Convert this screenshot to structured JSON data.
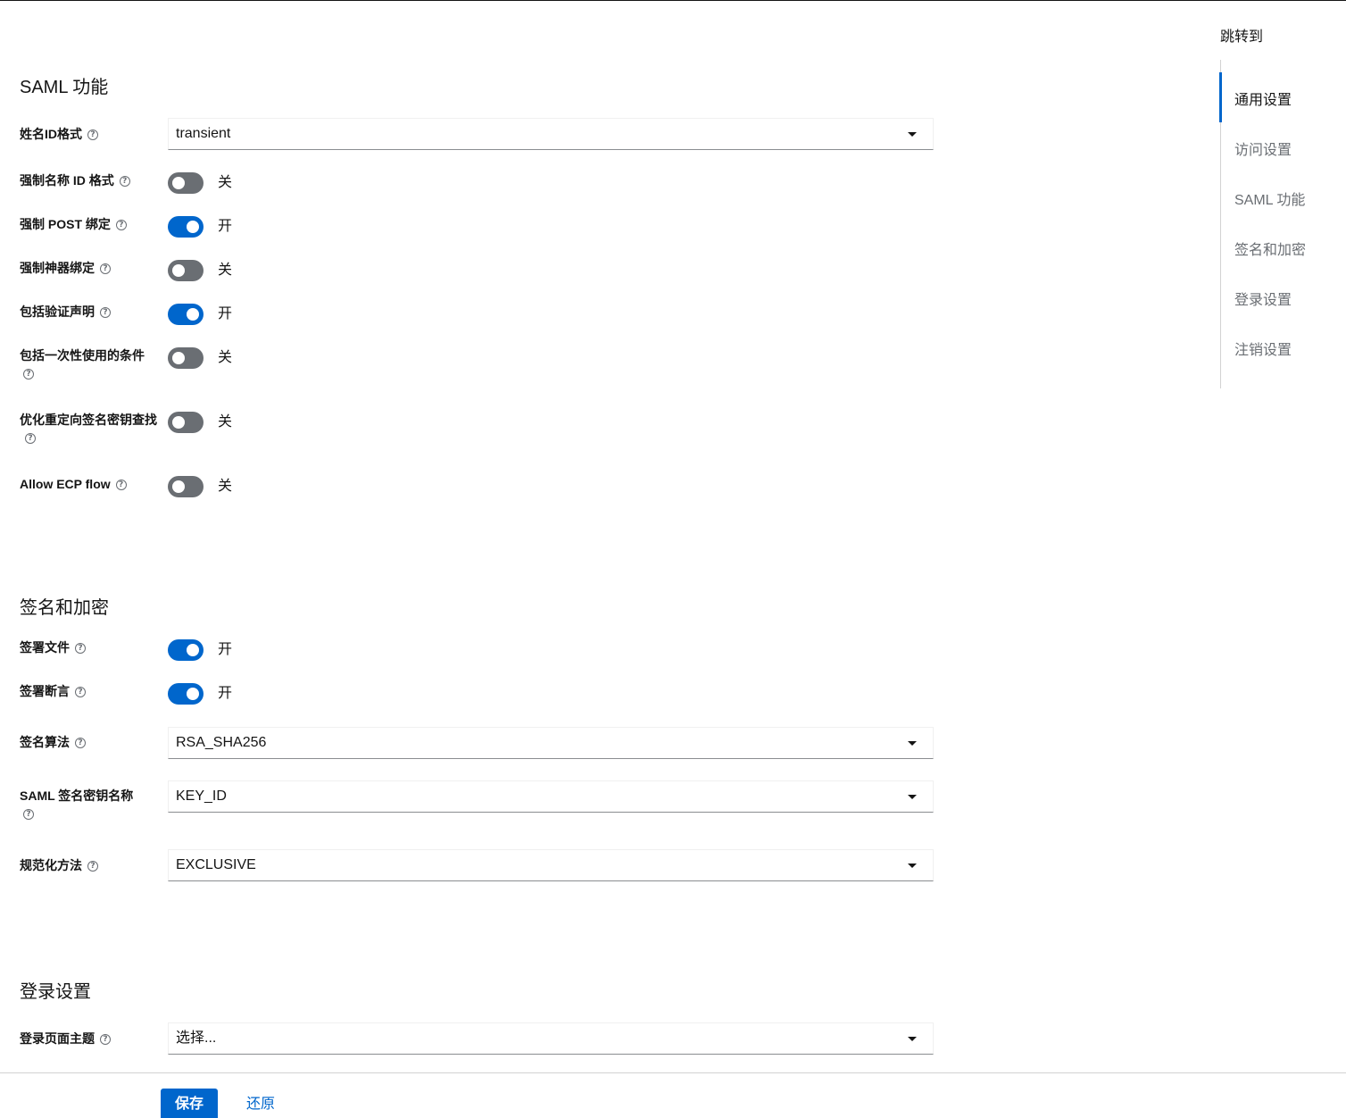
{
  "jump_to": {
    "title": "跳转到",
    "items": [
      {
        "label": "通用设置",
        "active": true
      },
      {
        "label": "访问设置",
        "active": false
      },
      {
        "label": "SAML 功能",
        "active": false
      },
      {
        "label": "签名和加密",
        "active": false
      },
      {
        "label": "登录设置",
        "active": false
      },
      {
        "label": "注销设置",
        "active": false
      }
    ]
  },
  "saml": {
    "title": "SAML 功能",
    "name_id_format": {
      "label": "姓名ID格式",
      "value": "transient"
    },
    "force_name_id_format": {
      "label": "强制名称 ID 格式",
      "state": "关",
      "on": false
    },
    "force_post_binding": {
      "label": "强制 POST 绑定",
      "state": "开",
      "on": true
    },
    "force_artifact_binding": {
      "label": "强制神器绑定",
      "state": "关",
      "on": false
    },
    "include_authn_statement": {
      "label": "包括验证声明",
      "state": "开",
      "on": true
    },
    "include_one_time_use": {
      "label": "包括一次性使用的条件",
      "state": "关",
      "on": false
    },
    "optimize_redirect": {
      "label": "优化重定向签名密钥查找",
      "state": "关",
      "on": false
    },
    "allow_ecp_flow": {
      "label": "Allow ECP flow",
      "state": "关",
      "on": false
    }
  },
  "signature": {
    "title": "签名和加密",
    "sign_documents": {
      "label": "签署文件",
      "state": "开",
      "on": true
    },
    "sign_assertions": {
      "label": "签署断言",
      "state": "开",
      "on": true
    },
    "signature_algorithm": {
      "label": "签名算法",
      "value": "RSA_SHA256"
    },
    "key_name": {
      "label": "SAML 签名密钥名称",
      "value": "KEY_ID"
    },
    "canonicalization": {
      "label": "规范化方法",
      "value": "EXCLUSIVE"
    }
  },
  "login": {
    "title": "登录设置",
    "login_theme": {
      "label": "登录页面主题",
      "value": "选择..."
    }
  },
  "footer": {
    "save_label": "保存",
    "revert_label": "还原"
  },
  "colors": {
    "accent": "#0066cc",
    "switch_off": "#6a6e73",
    "text": "#151515",
    "muted": "#6a6e73"
  },
  "icons": {
    "help": "question-circle-icon",
    "caret": "caret-down-icon"
  }
}
